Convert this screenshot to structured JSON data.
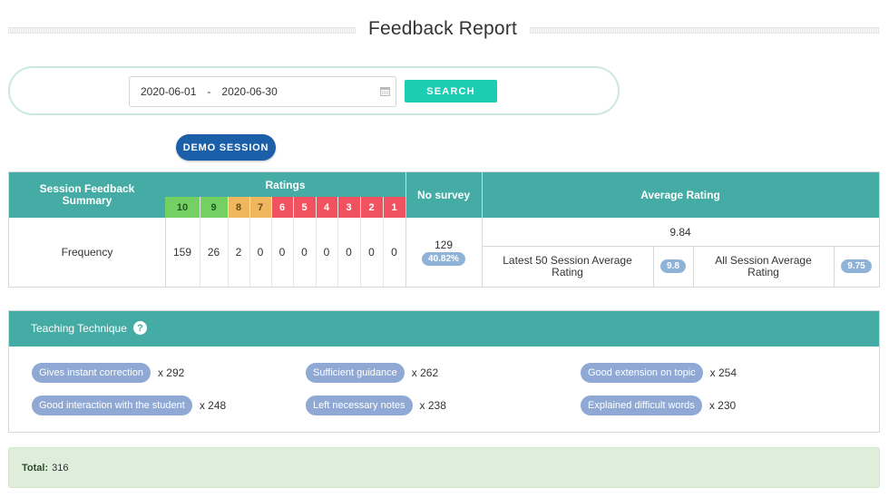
{
  "page": {
    "title": "Feedback Report"
  },
  "search": {
    "date_from": "2020-06-01",
    "date_separator": "-",
    "date_to": "2020-06-30",
    "button_label": "SEARCH"
  },
  "session_filter": {
    "label": "DEMO SESSION"
  },
  "summary": {
    "header_summary": "Session Feedback Summary",
    "header_ratings": "Ratings",
    "header_no_survey": "No survey",
    "header_average": "Average Rating",
    "row_label": "Frequency",
    "ratings": [
      {
        "score": "10",
        "count": "159",
        "color": "#74d062"
      },
      {
        "score": "9",
        "count": "26",
        "color": "#74d062"
      },
      {
        "score": "8",
        "count": "2",
        "color": "#efb65e"
      },
      {
        "score": "7",
        "count": "0",
        "color": "#efb65e"
      },
      {
        "score": "6",
        "count": "0",
        "color": "#f0535f"
      },
      {
        "score": "5",
        "count": "0",
        "color": "#f0535f"
      },
      {
        "score": "4",
        "count": "0",
        "color": "#f0535f"
      },
      {
        "score": "3",
        "count": "0",
        "color": "#f0535f"
      },
      {
        "score": "2",
        "count": "0",
        "color": "#f0535f"
      },
      {
        "score": "1",
        "count": "0",
        "color": "#f0535f"
      }
    ],
    "no_survey_count": "129",
    "no_survey_percent": "40.82%",
    "average": "9.84",
    "latest_label": "Latest 50 Session Average Rating",
    "latest_value": "9.8",
    "all_label": "All Session Average Rating",
    "all_value": "9.75"
  },
  "teaching": {
    "title": "Teaching Technique",
    "help_icon": "?",
    "tags": [
      {
        "label": "Gives instant correction",
        "count": "x 292"
      },
      {
        "label": "Sufficient guidance",
        "count": "x 262"
      },
      {
        "label": "Good extension on topic",
        "count": "x 254"
      },
      {
        "label": "Good interaction with the student",
        "count": "x 248"
      },
      {
        "label": "Left necessary notes",
        "count": "x 238"
      },
      {
        "label": "Explained difficult words",
        "count": "x 230"
      }
    ]
  },
  "total": {
    "label": "Total:",
    "value": "316"
  },
  "colors": {
    "header_teal": "#44aca4",
    "search_button": "#1ccdb3",
    "demo_button": "#1b5fa8",
    "tag": "#8fa9d4",
    "total_bg": "#dfeedb"
  }
}
